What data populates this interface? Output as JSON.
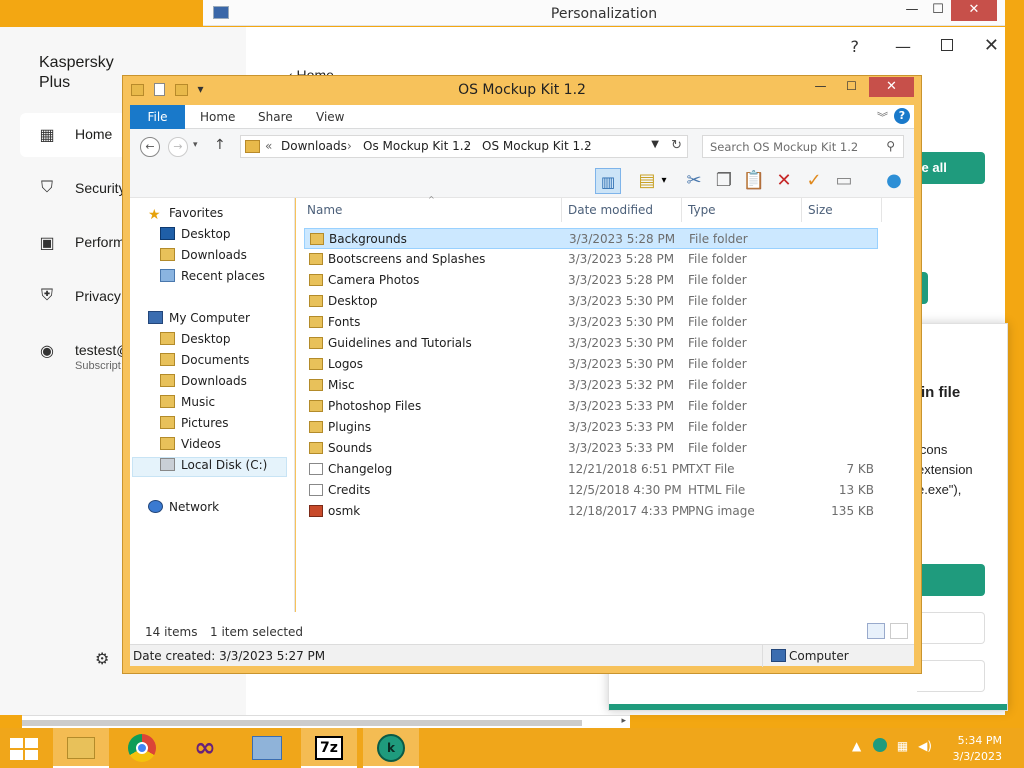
{
  "personalization": {
    "title": "Personalization",
    "min": "—",
    "max": "☐",
    "close": "✕"
  },
  "kaspersky": {
    "brand": "Kaspersky Plus",
    "nav": [
      {
        "label": "Home",
        "icon": "grid-icon"
      },
      {
        "label": "Security",
        "icon": "shield-icon"
      },
      {
        "label": "Perform",
        "icon": "monitor-icon"
      },
      {
        "label": "Privacy",
        "icon": "privacy-shield-icon"
      },
      {
        "label": "testest@",
        "sub": "Subscript",
        "icon": "user-icon"
      }
    ],
    "back_label": "‹ Home",
    "update_btn": "ate all",
    "help": "?",
    "min": "—",
    "close": "✕",
    "panel": {
      "title": "in file",
      "line1": "icons",
      "line2": "extension",
      "line3": "e.exe\"),"
    }
  },
  "explorer": {
    "title": "OS Mockup Kit 1.2",
    "ribbon": {
      "file": "File",
      "tabs": [
        "Home",
        "Share",
        "View"
      ],
      "help": "?"
    },
    "address": {
      "overflow": "«",
      "segments": [
        "Downloads",
        "Os Mockup Kit 1.2",
        "OS Mockup Kit 1.2"
      ],
      "sep": "›"
    },
    "search_placeholder": "Search OS Mockup Kit 1.2",
    "columns": {
      "name": "Name",
      "date": "Date modified",
      "type": "Type",
      "size": "Size"
    },
    "nav": {
      "favorites": "Favorites",
      "fav_items": [
        "Desktop",
        "Downloads",
        "Recent places"
      ],
      "computer": "My Computer",
      "comp_items": [
        "Desktop",
        "Documents",
        "Downloads",
        "Music",
        "Pictures",
        "Videos",
        "Local Disk (C:)"
      ],
      "network": "Network"
    },
    "files": [
      {
        "name": "Backgrounds",
        "date": "3/3/2023 5:28 PM",
        "type": "File folder",
        "size": "",
        "icon": "folder"
      },
      {
        "name": "Bootscreens and Splashes",
        "date": "3/3/2023 5:28 PM",
        "type": "File folder",
        "size": "",
        "icon": "folder"
      },
      {
        "name": "Camera Photos",
        "date": "3/3/2023 5:28 PM",
        "type": "File folder",
        "size": "",
        "icon": "folder"
      },
      {
        "name": "Desktop",
        "date": "3/3/2023 5:30 PM",
        "type": "File folder",
        "size": "",
        "icon": "folder"
      },
      {
        "name": "Fonts",
        "date": "3/3/2023 5:30 PM",
        "type": "File folder",
        "size": "",
        "icon": "folder"
      },
      {
        "name": "Guidelines and Tutorials",
        "date": "3/3/2023 5:30 PM",
        "type": "File folder",
        "size": "",
        "icon": "folder"
      },
      {
        "name": "Logos",
        "date": "3/3/2023 5:30 PM",
        "type": "File folder",
        "size": "",
        "icon": "folder"
      },
      {
        "name": "Misc",
        "date": "3/3/2023 5:32 PM",
        "type": "File folder",
        "size": "",
        "icon": "folder"
      },
      {
        "name": "Photoshop Files",
        "date": "3/3/2023 5:33 PM",
        "type": "File folder",
        "size": "",
        "icon": "folder"
      },
      {
        "name": "Plugins",
        "date": "3/3/2023 5:33 PM",
        "type": "File folder",
        "size": "",
        "icon": "folder"
      },
      {
        "name": "Sounds",
        "date": "3/3/2023 5:33 PM",
        "type": "File folder",
        "size": "",
        "icon": "folder"
      },
      {
        "name": "Changelog",
        "date": "12/21/2018 6:51 PM",
        "type": "TXT File",
        "size": "7 KB",
        "icon": "txt"
      },
      {
        "name": "Credits",
        "date": "12/5/2018 4:30 PM",
        "type": "HTML File",
        "size": "13 KB",
        "icon": "html"
      },
      {
        "name": "osmk",
        "date": "12/18/2017 4:33 PM",
        "type": "PNG image",
        "size": "135 KB",
        "icon": "png"
      }
    ],
    "status": {
      "items": "14 items",
      "selected": "1 item selected"
    },
    "details": {
      "created": "Date created: 3/3/2023 5:27 PM",
      "location": "Computer"
    }
  },
  "taskbar": {
    "apps": [
      "File Explorer",
      "Chrome",
      "Visual Studio",
      "Control Panel",
      "7-Zip",
      "Kaspersky"
    ],
    "time": "5:34 PM",
    "date": "3/3/2023"
  },
  "colors": {
    "accent": "#f3a712",
    "kaspersky_green": "#1f9b7d",
    "explorer_blue": "#1979ca",
    "close_red": "#c7504a"
  }
}
